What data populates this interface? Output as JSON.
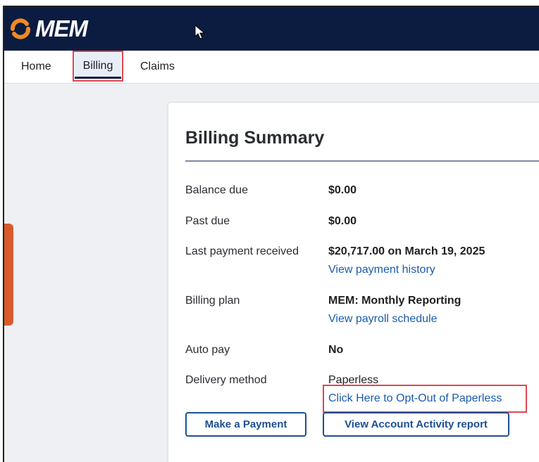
{
  "app": {
    "logo_text": "MEM",
    "colors": {
      "header_bg": "#0b1c40",
      "logo_accent": "#f08a24",
      "link": "#1a5bb0",
      "button_border": "#1d4f94",
      "highlight_box": "#e2454f",
      "side_tab": "#d95a2b"
    }
  },
  "nav": {
    "items": [
      {
        "label": "Home"
      },
      {
        "label": "Billing",
        "active": true
      },
      {
        "label": "Claims"
      }
    ]
  },
  "billing_summary": {
    "title": "Billing Summary",
    "rows": {
      "balance_due": {
        "label": "Balance due",
        "value": "$0.00"
      },
      "past_due": {
        "label": "Past due",
        "value": "$0.00"
      },
      "last_payment": {
        "label": "Last payment received",
        "value": "$20,717.00 on March 19, 2025",
        "link": "View payment history"
      },
      "billing_plan": {
        "label": "Billing plan",
        "value": "MEM: Monthly Reporting",
        "link": "View payroll schedule"
      },
      "auto_pay": {
        "label": "Auto pay",
        "value": "No"
      },
      "delivery_method": {
        "label": "Delivery method",
        "value": "Paperless",
        "link": "Click Here to Opt-Out of Paperless"
      }
    },
    "buttons": {
      "make_payment": "Make a Payment",
      "view_activity": "View Account Activity report"
    }
  },
  "icons": {
    "logo": "mem-logo-icon",
    "cursor": "mouse-cursor-icon"
  }
}
